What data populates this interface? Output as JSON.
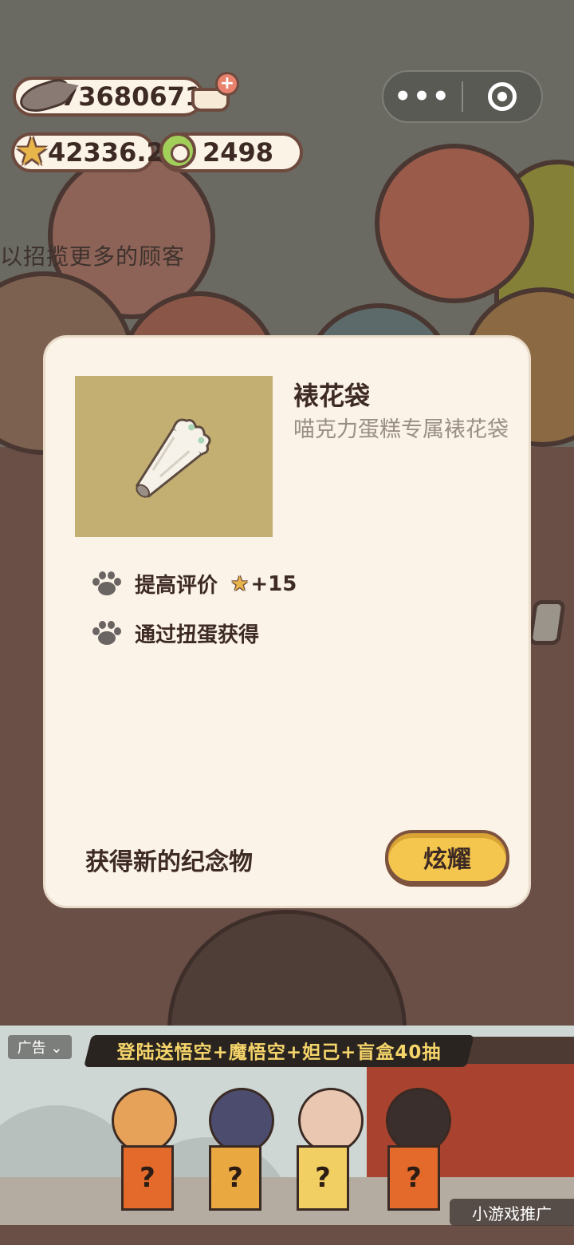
{
  "currency": {
    "fish": "73680671",
    "stars": "42336.2",
    "rings": "2498"
  },
  "capsule": {
    "more_label": "•••"
  },
  "background": {
    "tip": "以招揽更多的顾客"
  },
  "dialog": {
    "item_name": "裱花袋",
    "item_desc": "喵克力蛋糕专属裱花袋",
    "effects": [
      {
        "label": "提高评价",
        "bonus": "+15"
      },
      {
        "label": "通过扭蛋获得"
      }
    ],
    "footer_label": "获得新的纪念物",
    "show_button": "炫耀"
  },
  "ad": {
    "tag": "广告 ⌄",
    "headline": "登陆送悟空+魔悟空+妲己+盲盒40抽",
    "box_mark": "?",
    "promo_label": "小游戏推广"
  }
}
